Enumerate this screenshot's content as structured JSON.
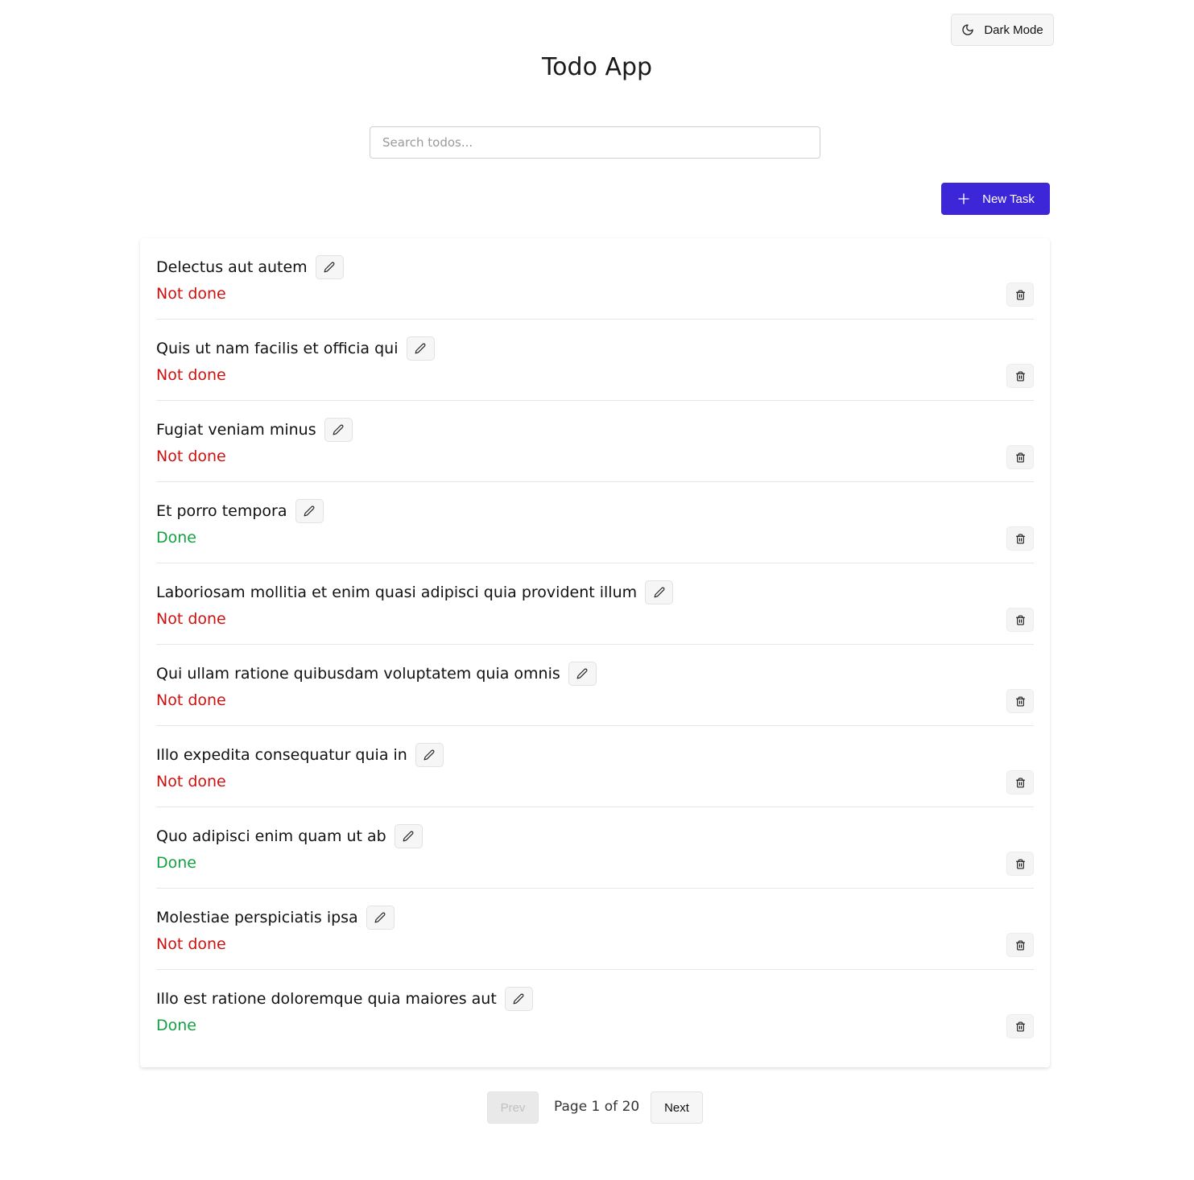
{
  "header": {
    "dark_mode_label": "Dark Mode",
    "dark_mode_icon": "moon-icon",
    "title": "Todo App"
  },
  "search": {
    "placeholder": "Search todos...",
    "value": ""
  },
  "toolbar": {
    "new_task_label": "New Task",
    "new_task_icon": "plus-icon"
  },
  "todos": [
    {
      "title": "Delectus aut autem",
      "status": "Not done",
      "done": false
    },
    {
      "title": "Quis ut nam facilis et officia qui",
      "status": "Not done",
      "done": false
    },
    {
      "title": "Fugiat veniam minus",
      "status": "Not done",
      "done": false
    },
    {
      "title": "Et porro tempora",
      "status": "Done",
      "done": true
    },
    {
      "title": "Laboriosam mollitia et enim quasi adipisci quia provident illum",
      "status": "Not done",
      "done": false
    },
    {
      "title": "Qui ullam ratione quibusdam voluptatem quia omnis",
      "status": "Not done",
      "done": false
    },
    {
      "title": "Illo expedita consequatur quia in",
      "status": "Not done",
      "done": false
    },
    {
      "title": "Quo adipisci enim quam ut ab",
      "status": "Done",
      "done": true
    },
    {
      "title": "Molestiae perspiciatis ipsa",
      "status": "Not done",
      "done": false
    },
    {
      "title": "Illo est ratione doloremque quia maiores aut",
      "status": "Done",
      "done": true
    }
  ],
  "item_icons": {
    "edit": "pencil-icon",
    "delete": "trash-icon"
  },
  "pagination": {
    "prev_label": "Prev",
    "next_label": "Next",
    "page_text": "Page 1 of 20",
    "prev_disabled": true
  },
  "colors": {
    "accent": "#3d25d8",
    "not_done": "#cc1111",
    "done": "#15a043"
  }
}
